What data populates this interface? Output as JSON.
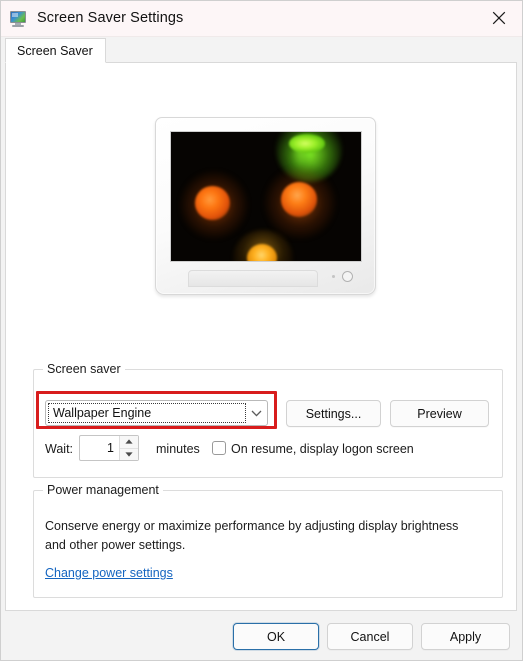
{
  "window": {
    "title": "Screen Saver Settings",
    "icon": "monitor-icon",
    "close_label": "✕"
  },
  "tabs": [
    {
      "label": "Screen Saver",
      "selected": true
    }
  ],
  "preview": {
    "alt": "monitor-preview",
    "screen_background": "#060402",
    "blobs": [
      {
        "name": "green-blob",
        "color": "#9ef02a",
        "position": "top-right"
      },
      {
        "name": "orange-blob-left",
        "color": "#fd7511",
        "position": "mid-left"
      },
      {
        "name": "orange-blob-right",
        "color": "#fd7d15",
        "position": "mid-right"
      },
      {
        "name": "yellow-blob-bottom",
        "color": "#ffb121",
        "position": "bottom-center"
      }
    ]
  },
  "screen_saver_group": {
    "title": "Screen saver",
    "combo": {
      "value": "Wallpaper Engine",
      "arrow_icon": "chevron-down-icon",
      "focused": true,
      "highlighted": true,
      "highlight_color": "#d81d1d"
    },
    "settings_button": "Settings...",
    "preview_button": "Preview",
    "wait_label": "Wait:",
    "wait_value": "1",
    "minutes_label": "minutes",
    "logon_checkbox_label": "On resume, display logon screen",
    "logon_checkbox_checked": false
  },
  "power_group": {
    "title": "Power management",
    "description": "Conserve energy or maximize performance by adjusting display brightness and other power settings.",
    "link": "Change power settings",
    "link_color": "#1565c0"
  },
  "footer": {
    "ok": "OK",
    "cancel": "Cancel",
    "apply": "Apply",
    "default_button": "OK",
    "accent_color": "#2a6fa8"
  }
}
